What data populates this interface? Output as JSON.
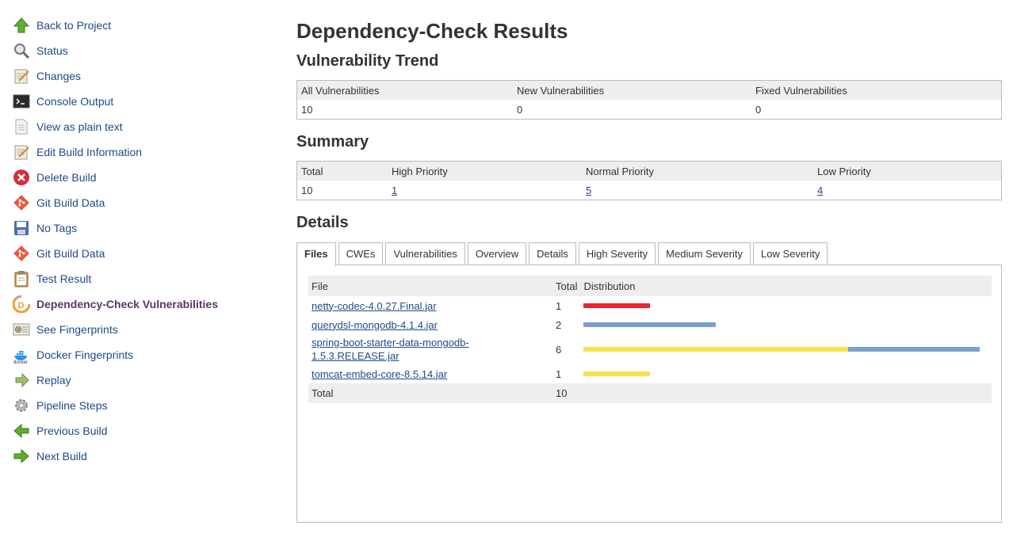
{
  "sidebar": {
    "items": [
      {
        "label": "Back to Project",
        "icon": "up-arrow-icon"
      },
      {
        "label": "Status",
        "icon": "search-icon"
      },
      {
        "label": "Changes",
        "icon": "notepad-icon"
      },
      {
        "label": "Console Output",
        "icon": "terminal-icon"
      },
      {
        "label": "View as plain text",
        "icon": "document-icon"
      },
      {
        "label": "Edit Build Information",
        "icon": "notepad-icon"
      },
      {
        "label": "Delete Build",
        "icon": "delete-icon"
      },
      {
        "label": "Git Build Data",
        "icon": "git-icon"
      },
      {
        "label": "No Tags",
        "icon": "save-icon"
      },
      {
        "label": "Git Build Data",
        "icon": "git-icon"
      },
      {
        "label": "Test Result",
        "icon": "clipboard-icon"
      },
      {
        "label": "Dependency-Check Vulnerabilities",
        "icon": "dependency-check-icon",
        "active": true
      },
      {
        "label": "See Fingerprints",
        "icon": "fingerprint-icon"
      },
      {
        "label": "Docker Fingerprints",
        "icon": "docker-icon"
      },
      {
        "label": "Replay",
        "icon": "replay-arrow-icon"
      },
      {
        "label": "Pipeline Steps",
        "icon": "gear-icon"
      },
      {
        "label": "Previous Build",
        "icon": "left-arrow-icon"
      },
      {
        "label": "Next Build",
        "icon": "right-arrow-icon"
      }
    ]
  },
  "page": {
    "title": "Dependency-Check Results",
    "trend_heading": "Vulnerability Trend",
    "summary_heading": "Summary",
    "details_heading": "Details"
  },
  "trend": {
    "headers": [
      "All Vulnerabilities",
      "New Vulnerabilities",
      "Fixed Vulnerabilities"
    ],
    "values": [
      "10",
      "0",
      "0"
    ]
  },
  "summary": {
    "headers": [
      "Total",
      "High Priority",
      "Normal Priority",
      "Low Priority"
    ],
    "values": [
      "10",
      "1",
      "5",
      "4"
    ]
  },
  "tabs": [
    {
      "label": "Files",
      "active": true
    },
    {
      "label": "CWEs"
    },
    {
      "label": "Vulnerabilities"
    },
    {
      "label": "Overview"
    },
    {
      "label": "Details"
    },
    {
      "label": "High Severity"
    },
    {
      "label": "Medium Severity"
    },
    {
      "label": "Low Severity"
    }
  ],
  "files": {
    "headers": [
      "File",
      "Total",
      "Distribution"
    ],
    "rows": [
      {
        "file": "netty-codec-4.0.27.Final.jar",
        "total": "1",
        "high": 1,
        "normal": 0,
        "low": 0
      },
      {
        "file": "querydsl-mongodb-4.1.4.jar",
        "total": "2",
        "high": 0,
        "normal": 0,
        "low": 2
      },
      {
        "file": "spring-boot-starter-data-mongodb-1.5.3.RELEASE.jar",
        "total": "6",
        "high": 0,
        "normal": 4,
        "low": 2
      },
      {
        "file": "tomcat-embed-core-8.5.14.jar",
        "total": "1",
        "high": 0,
        "normal": 1,
        "low": 0
      }
    ],
    "total_label": "Total",
    "total_value": "10",
    "max_total": 6
  },
  "colors": {
    "high": "#e8262b",
    "normal": "#f5e34a",
    "low": "#7c9fcd",
    "link": "#204a87",
    "active_sidebar": "#5c3566"
  }
}
